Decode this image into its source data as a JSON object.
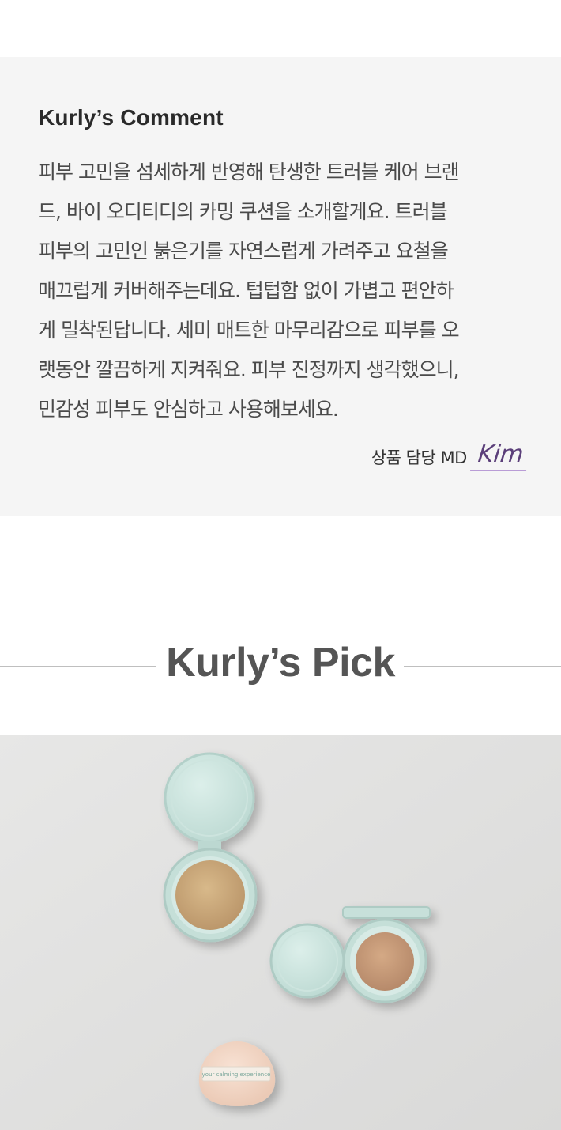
{
  "comment": {
    "title": "Kurly’s Comment",
    "lines": [
      "피부 고민을 섬세하게 반영해 탄생한 트러블 케어 브랜",
      "드, 바이 오디티디의 카밍 쿠션을 소개할게요. 트러블",
      "피부의 고민인 붉은기를 자연스럽게 가려주고 요철을",
      "매끄럽게 커버해주는데요. 텁텁함 없이 가볍고 편안하",
      "게 밀착된답니다. 세미 매트한 마무리감으로 피부를 오",
      "랫동안 깔끔하게 지켜줘요. 피부 진정까지 생각했으니,",
      "민감성 피부도 안심하고 사용해보세요."
    ],
    "md_label": "상품 담당 MD",
    "md_name": "Kim"
  },
  "pick": {
    "title": "Kurly’s Pick"
  },
  "photo": {
    "puff_text": "your calming experience",
    "colors": {
      "background": "#e4e4e4",
      "case": "#c9e2dc",
      "case_edge": "#b3d0c9",
      "cushion_left": "#c9a77a",
      "cushion_right": "#c79d7c",
      "puff": "#f2d6c6"
    }
  }
}
